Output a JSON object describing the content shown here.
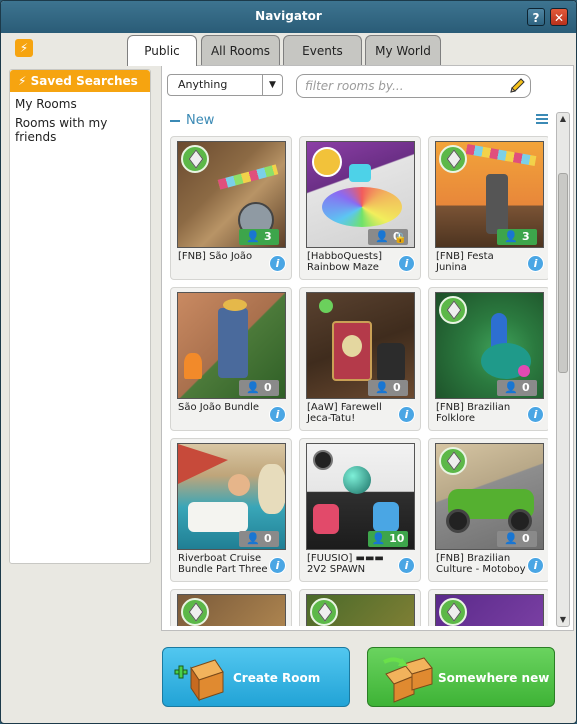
{
  "window": {
    "title": "Navigator",
    "help_label": "?",
    "close_label": "✕"
  },
  "header": {
    "quick_icon": "lightning-icon",
    "quick_label": "⚡"
  },
  "tabs": [
    {
      "label": "Public",
      "active": true
    },
    {
      "label": "All Rooms",
      "active": false
    },
    {
      "label": "Events",
      "active": false
    },
    {
      "label": "My World",
      "active": false
    }
  ],
  "sidebar": {
    "saved_searches_label": "Saved Searches",
    "items": [
      {
        "label": "My Rooms"
      },
      {
        "label": "Rooms with my friends"
      }
    ]
  },
  "filter": {
    "dropdown_value": "Anything",
    "search_placeholder": "filter rooms by..."
  },
  "section": {
    "title": "New"
  },
  "rooms": [
    {
      "name": "[FNB] São João",
      "count": "3",
      "occupied": true,
      "public": true
    },
    {
      "name": "[HabboQuests] Rainbow Maze",
      "count": "0",
      "occupied": false,
      "public": false,
      "locked": true
    },
    {
      "name": "[FNB] Festa Junina",
      "count": "3",
      "occupied": true,
      "public": true
    },
    {
      "name": "São João Bundle",
      "count": "0",
      "occupied": false,
      "public": false
    },
    {
      "name": "[AaW] Farewell Jeca-Tatu!",
      "count": "0",
      "occupied": false,
      "public": false
    },
    {
      "name": "[FNB] Brazilian Folklore",
      "count": "0",
      "occupied": false,
      "public": true
    },
    {
      "name": "Riverboat Cruise Bundle Part Three",
      "count": "0",
      "occupied": false,
      "public": false
    },
    {
      "name": "[FUUSIO] ▬▬▬ 2V2 SPAWN",
      "count": "10",
      "occupied": true,
      "public": false
    },
    {
      "name": "[FNB] Brazilian Culture - Motoboy",
      "count": "0",
      "occupied": false,
      "public": true
    }
  ],
  "buttons": {
    "create_room": "Create Room",
    "somewhere_new": "Somewhere new"
  },
  "colors": {
    "accent_orange": "#f6a410",
    "occupied_green": "#3da54b",
    "empty_gray": "#8a8a8a",
    "info_blue": "#4aa6e4"
  }
}
